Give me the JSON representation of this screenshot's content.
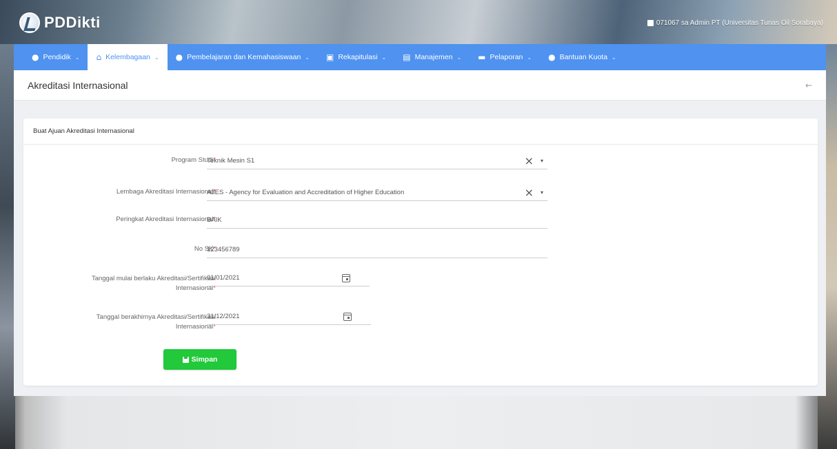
{
  "app": {
    "logo_text": "PDDikti",
    "user_info": "071067 sa Admin PT (Universitas Tunas Oil Sorabaya)"
  },
  "nav": {
    "items": [
      {
        "icon": "user-circle-icon",
        "label": "Pendidik"
      },
      {
        "icon": "institution-icon",
        "label": "Kelembagaan"
      },
      {
        "icon": "user-circle-icon",
        "label": "Pembelajaran dan Kemahasiswaan"
      },
      {
        "icon": "chart-icon",
        "label": "Rekapitulasi"
      },
      {
        "icon": "document-icon",
        "label": "Manajemen"
      },
      {
        "icon": "folder-icon",
        "label": "Pelaporan"
      },
      {
        "icon": "user-circle-icon",
        "label": "Bantuan Kuota"
      }
    ],
    "active_index": 1
  },
  "page": {
    "title": "Akreditasi Internasional",
    "back_icon": "arrow-left-icon"
  },
  "form": {
    "header": "Buat Ajuan Akreditasi Internasional",
    "program_studi": {
      "label": "Program Studi",
      "value": "Teknik Mesin S1"
    },
    "lembaga": {
      "label": "Lembaga Akreditasi Internasional",
      "value": "A3ES - Agency for Evaluation and Accreditation of Higher Education"
    },
    "peringkat": {
      "label": "Peringkat Akreditasi Internasional",
      "value": "BAIK"
    },
    "no_sk": {
      "label": "No SK",
      "value": "123456789"
    },
    "tanggal_mulai": {
      "label_line1": "Tanggal mulai berlaku Akreditasi/Sertifikasi",
      "label_line2": "Internasional",
      "value": "01/01/2021"
    },
    "tanggal_akhir": {
      "label_line1": "Tanggal berakhirnya Akreditasi/Sertifikasi",
      "label_line2": "Internasional",
      "value": "31/12/2021"
    },
    "required_mark": "*",
    "save_label": "Simpan"
  },
  "colors": {
    "nav_bg": "#4f92f0",
    "save_bg": "#22c93a",
    "required": "#e53935"
  }
}
